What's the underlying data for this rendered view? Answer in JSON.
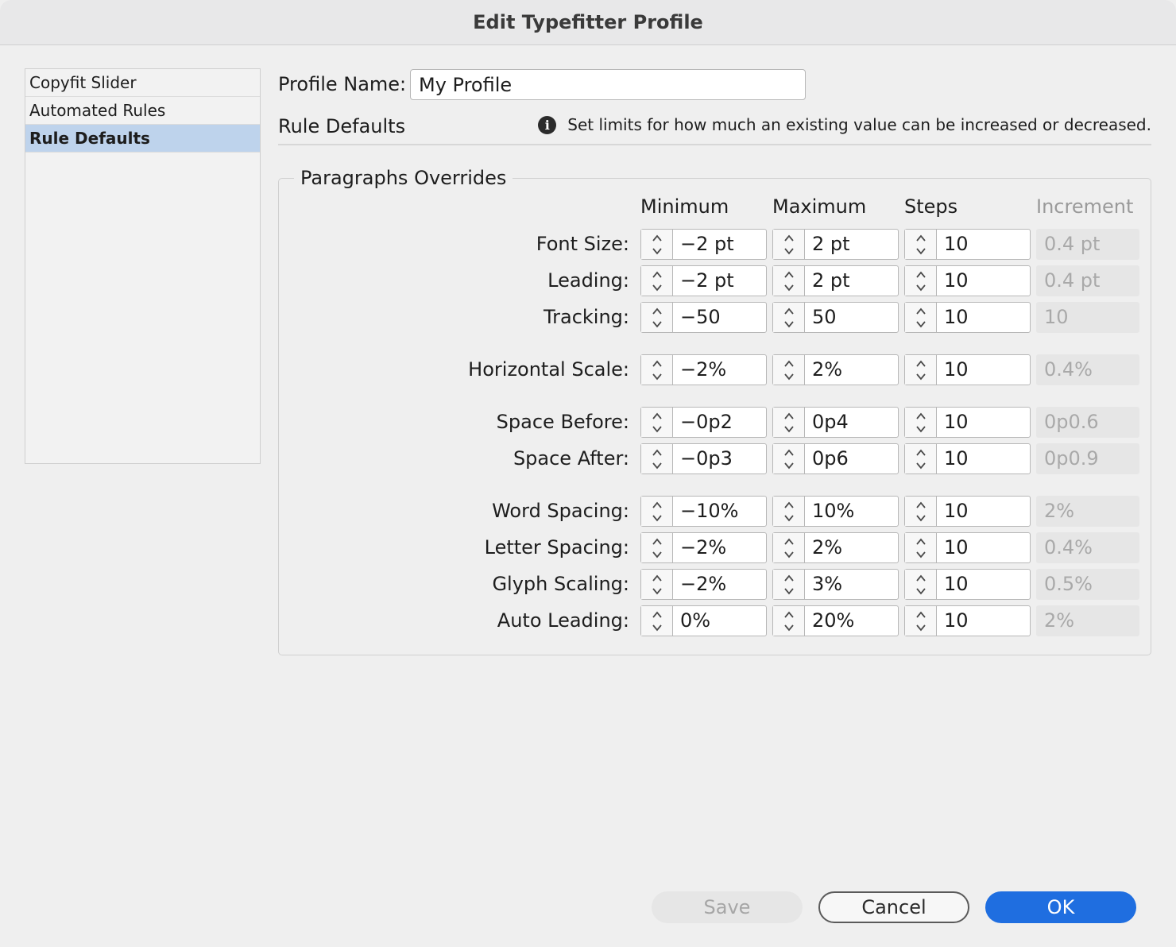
{
  "window": {
    "title": "Edit Typefitter Profile"
  },
  "sidebar": {
    "items": [
      {
        "label": "Copyfit Slider"
      },
      {
        "label": "Automated Rules"
      },
      {
        "label": "Rule Defaults"
      }
    ],
    "selected": "Rule Defaults"
  },
  "profile": {
    "label": "Profile Name:",
    "value": "My Profile"
  },
  "section": {
    "title": "Rule Defaults",
    "info": "Set limits for how much an existing value can be increased or decreased."
  },
  "group": {
    "title": "Paragraphs Overrides",
    "headers": {
      "min": "Minimum",
      "max": "Maximum",
      "steps": "Steps",
      "inc": "Increment"
    },
    "rows": [
      {
        "label": "Font Size:",
        "min": "−2 pt",
        "max": "2 pt",
        "steps": "10",
        "inc": "0.4 pt"
      },
      {
        "label": "Leading:",
        "min": "−2 pt",
        "max": "2 pt",
        "steps": "10",
        "inc": "0.4 pt"
      },
      {
        "label": "Tracking:",
        "min": "−50",
        "max": "50",
        "steps": "10",
        "inc": "10"
      },
      {
        "label": "Horizontal Scale:",
        "min": "−2%",
        "max": "2%",
        "steps": "10",
        "inc": "0.4%"
      },
      {
        "label": "Space Before:",
        "min": "−0p2",
        "max": "0p4",
        "steps": "10",
        "inc": "0p0.6"
      },
      {
        "label": "Space After:",
        "min": "−0p3",
        "max": "0p6",
        "steps": "10",
        "inc": "0p0.9"
      },
      {
        "label": "Word Spacing:",
        "min": "−10%",
        "max": "10%",
        "steps": "10",
        "inc": "2%"
      },
      {
        "label": "Letter Spacing:",
        "min": "−2%",
        "max": "2%",
        "steps": "10",
        "inc": "0.4%"
      },
      {
        "label": "Glyph Scaling:",
        "min": "−2%",
        "max": "3%",
        "steps": "10",
        "inc": "0.5%"
      },
      {
        "label": "Auto Leading:",
        "min": "0%",
        "max": "20%",
        "steps": "10",
        "inc": "2%"
      }
    ]
  },
  "buttons": {
    "save": "Save",
    "cancel": "Cancel",
    "ok": "OK"
  }
}
